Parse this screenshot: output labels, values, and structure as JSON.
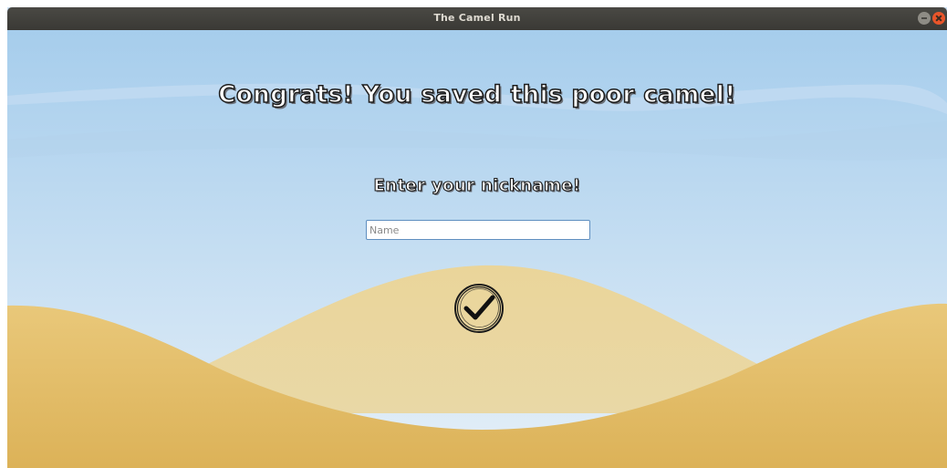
{
  "window": {
    "title": "The Camel Run"
  },
  "main": {
    "headline": "Congrats! You saved this poor camel!",
    "subheadline": "Enter your nickname!",
    "nickname_input": {
      "value": "",
      "placeholder": "Name"
    }
  },
  "icons": {
    "confirm": "checkmark-circle-icon",
    "minimize": "minimize-icon",
    "close": "close-icon"
  },
  "colors": {
    "sky_top": "#a6cdec",
    "sky_bottom": "#dcebf7",
    "dune_far": "#e8d59e",
    "dune_near": "#e2bc6a",
    "close_button": "#e9552a"
  }
}
